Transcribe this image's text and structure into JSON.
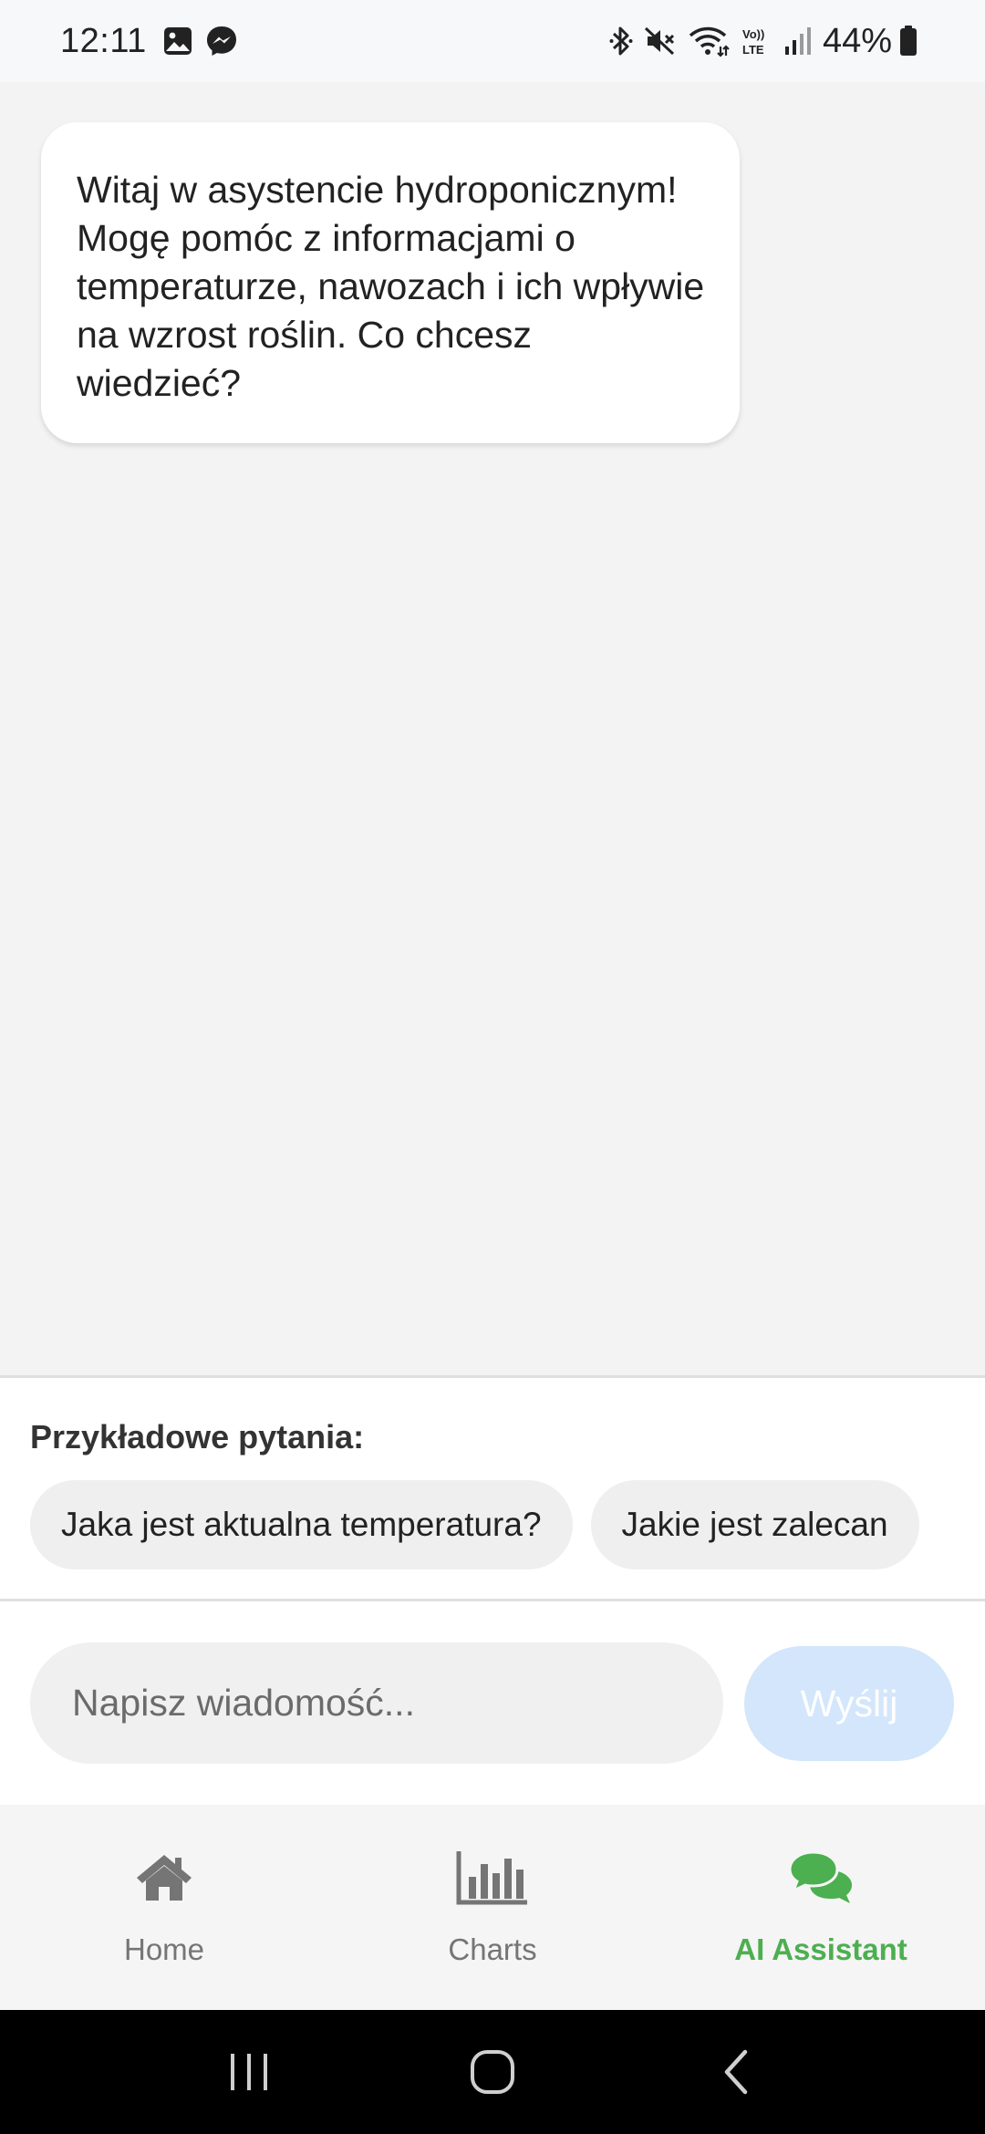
{
  "status_bar": {
    "time": "12:11",
    "battery_percent": "44%",
    "left_icons": [
      "gallery-icon",
      "messenger-icon"
    ],
    "right_icons": [
      "bluetooth-icon",
      "mute-icon",
      "wifi-icon",
      "volte-icon",
      "signal-icon",
      "battery-icon"
    ],
    "volte_text_top": "Vo))",
    "volte_text_bottom": "LTE"
  },
  "chat": {
    "messages": [
      {
        "role": "assistant",
        "text": "Witaj w asystencie hydroponicznym! Mogę pomóc z informacjami o temperaturze, nawozach i ich wpływie na wzrost roślin. Co chcesz wiedzieć?"
      }
    ]
  },
  "suggestions": {
    "title": "Przykładowe pytania:",
    "items": [
      "Jaka jest aktualna temperatura?",
      "Jakie jest zalecan"
    ]
  },
  "input": {
    "placeholder": "Napisz wiadomość...",
    "value": "",
    "send_label": "Wyślij"
  },
  "bottom_nav": {
    "items": [
      {
        "label": "Home",
        "icon": "home-icon",
        "active": false
      },
      {
        "label": "Charts",
        "icon": "bar-chart-icon",
        "active": false
      },
      {
        "label": "AI Assistant",
        "icon": "chat-bubbles-icon",
        "active": true
      }
    ]
  },
  "colors": {
    "accent_active": "#4caf50",
    "inactive": "#757575",
    "send_button_disabled": "#d3e6fb",
    "chat_background": "#f3f3f3"
  },
  "system_nav": {
    "buttons": [
      "recents-icon",
      "home-circle-icon",
      "back-icon"
    ]
  }
}
